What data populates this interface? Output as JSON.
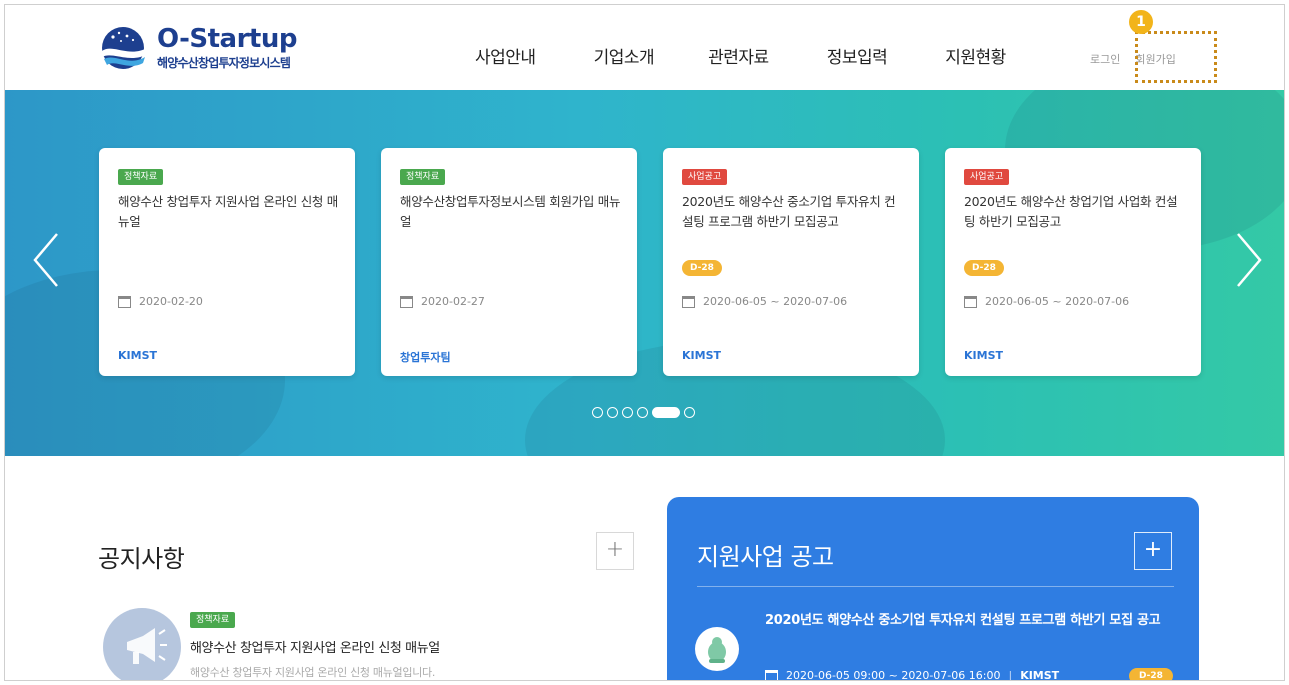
{
  "brand": {
    "title": "O-Startup",
    "subtitle": "해양수산창업투자정보시스템"
  },
  "nav": [
    "사업안내",
    "기업소개",
    "관련자료",
    "정보입력",
    "지원현황"
  ],
  "util": {
    "login": "로그인",
    "join": "회원가입",
    "callout_number": "1"
  },
  "slider": {
    "cards": [
      {
        "badge": "정책자료",
        "badge_color": "#4aa84e",
        "title": "해양수산 창업투자 지원사업 온라인 신청 매뉴얼",
        "dday": "",
        "date": "2020-02-20",
        "source": "KIMST"
      },
      {
        "badge": "정책자료",
        "badge_color": "#4aa84e",
        "title": "해양수산창업투자정보시스템 회원가입 매뉴얼",
        "dday": "",
        "date": "2020-02-27",
        "source": "창업투자팀"
      },
      {
        "badge": "사업공고",
        "badge_color": "#e0493f",
        "title": "2020년도 해양수산 중소기업 투자유치 컨설팅 프로그램 하반기 모집공고",
        "dday": "D-28",
        "date": "2020-06-05 ~ 2020-07-06",
        "source": "KIMST"
      },
      {
        "badge": "사업공고",
        "badge_color": "#e0493f",
        "title": "2020년도 해양수산 창업기업 사업화 컨설팅 하반기 모집공고",
        "dday": "D-28",
        "date": "2020-06-05 ~ 2020-07-06",
        "source": "KIMST"
      }
    ],
    "page_count": 6,
    "active_page": 5
  },
  "notice": {
    "title": "공지사항",
    "plus": "+",
    "item": {
      "badge": "정책자료",
      "title": "해양수산 창업투자 지원사업 온라인 신청 매뉴얼",
      "desc": "해양수산 창업투자 지원사업 온라인 신청 매뉴얼입니다."
    }
  },
  "support": {
    "title": "지원사업 공고",
    "plus": "+",
    "item": {
      "title": "2020년도 해양수산 중소기업 투자유치 컨설팅 프로그램 하반기 모집 공고",
      "date": "2020-06-05 09:00 ~ 2020-07-06 16:00",
      "sep": "|",
      "org": "KIMST",
      "dday": "D-28"
    }
  },
  "colors": {
    "brand_navy": "#1d3f8f",
    "panel_blue": "#2f7de2",
    "dday_orange": "#f4b534",
    "callout": "#c98a1a"
  }
}
